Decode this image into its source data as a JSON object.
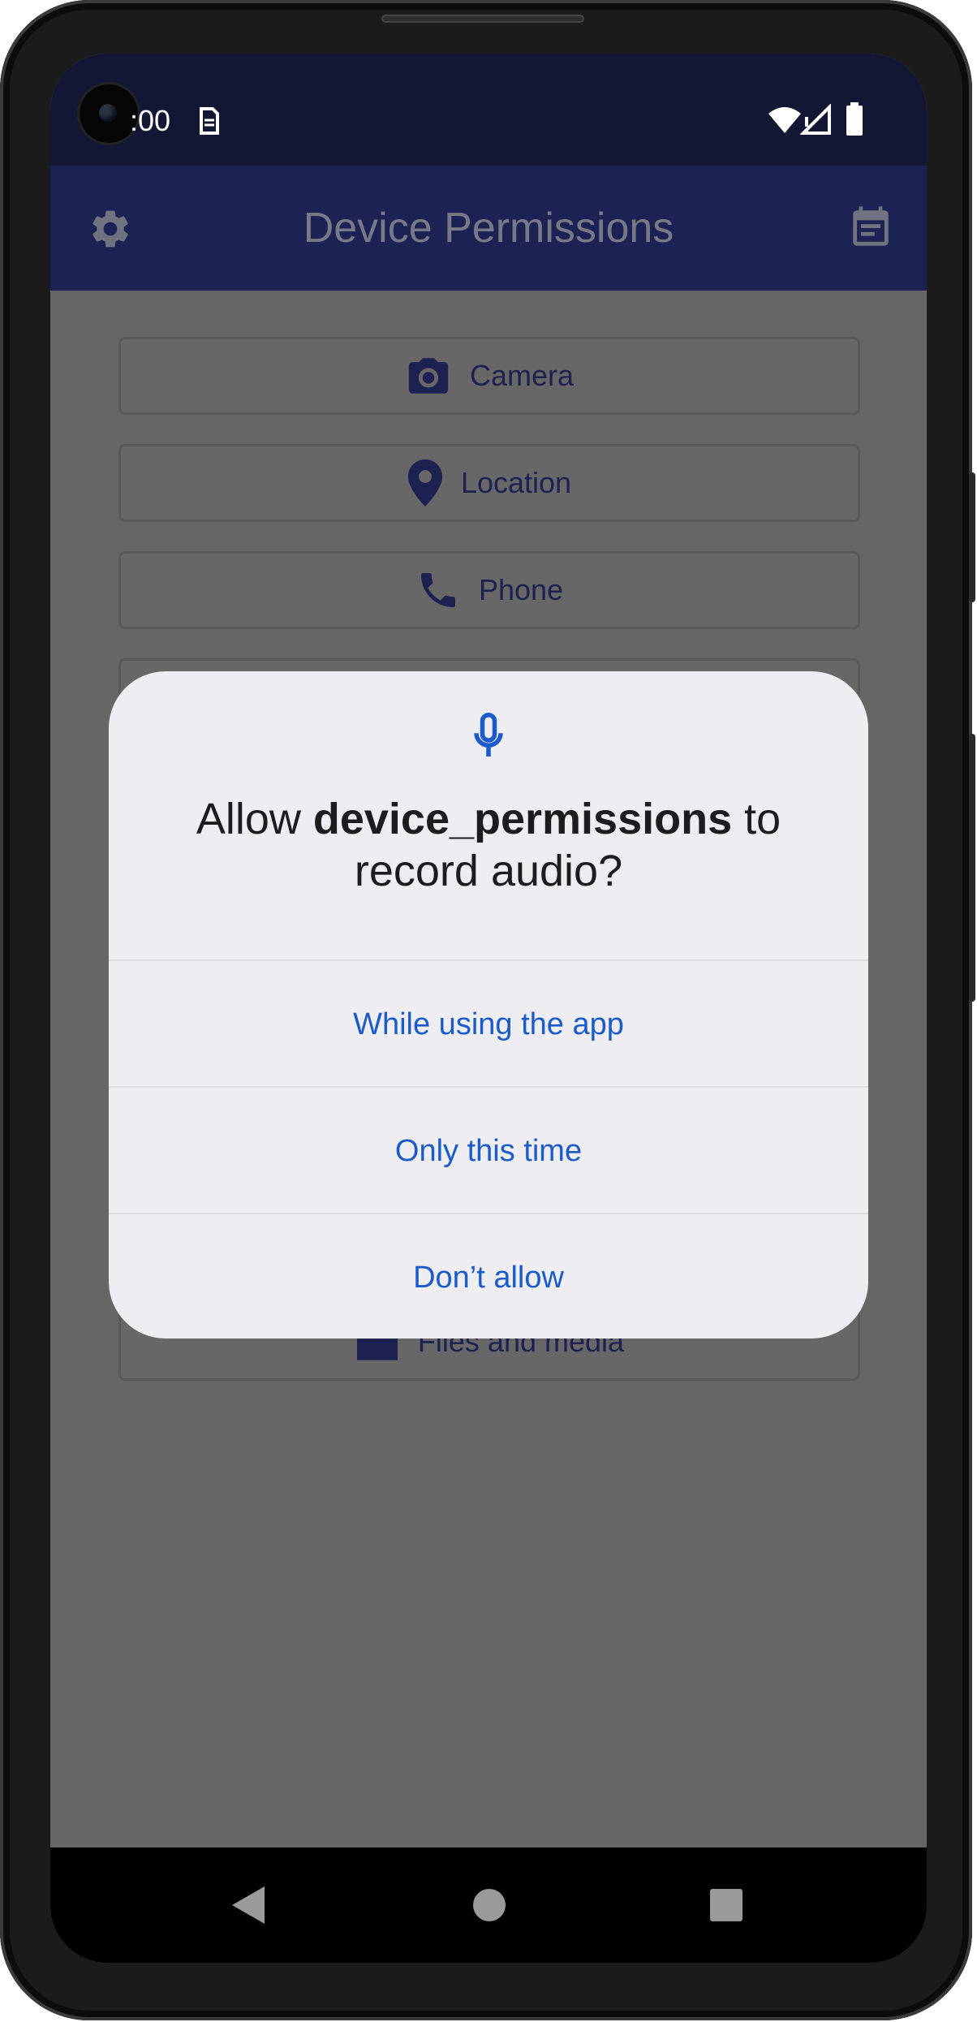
{
  "status_bar": {
    "time": ":00",
    "icons": [
      "sim-icon",
      "wifi-icon",
      "cell-signal-icon",
      "battery-icon"
    ]
  },
  "app_bar": {
    "title": "Device Permissions",
    "left_icon": "settings-gear-icon",
    "right_icon": "event-note-icon"
  },
  "permissions": {
    "items": [
      {
        "label": "Camera",
        "icon": "camera-icon"
      },
      {
        "label": "Location",
        "icon": "location-pin-icon"
      },
      {
        "label": "Phone",
        "icon": "phone-icon"
      },
      {
        "label": "Files and media",
        "icon": "folder-icon"
      }
    ]
  },
  "dialog": {
    "icon": "microphone-icon",
    "title_prefix": "Allow ",
    "title_app": "device_permissions",
    "title_suffix": " to record audio?",
    "options": [
      "While using the app",
      "Only this time",
      "Don’t allow"
    ]
  },
  "nav_bar": {
    "icons": [
      "back-icon",
      "home-icon",
      "recents-icon"
    ]
  },
  "colors": {
    "status_bar": "#141733",
    "app_bar": "#1d2254",
    "scrim_background": "#666666",
    "dialog_background": "#eeeef2",
    "dialog_accent": "#1a5bc9"
  }
}
